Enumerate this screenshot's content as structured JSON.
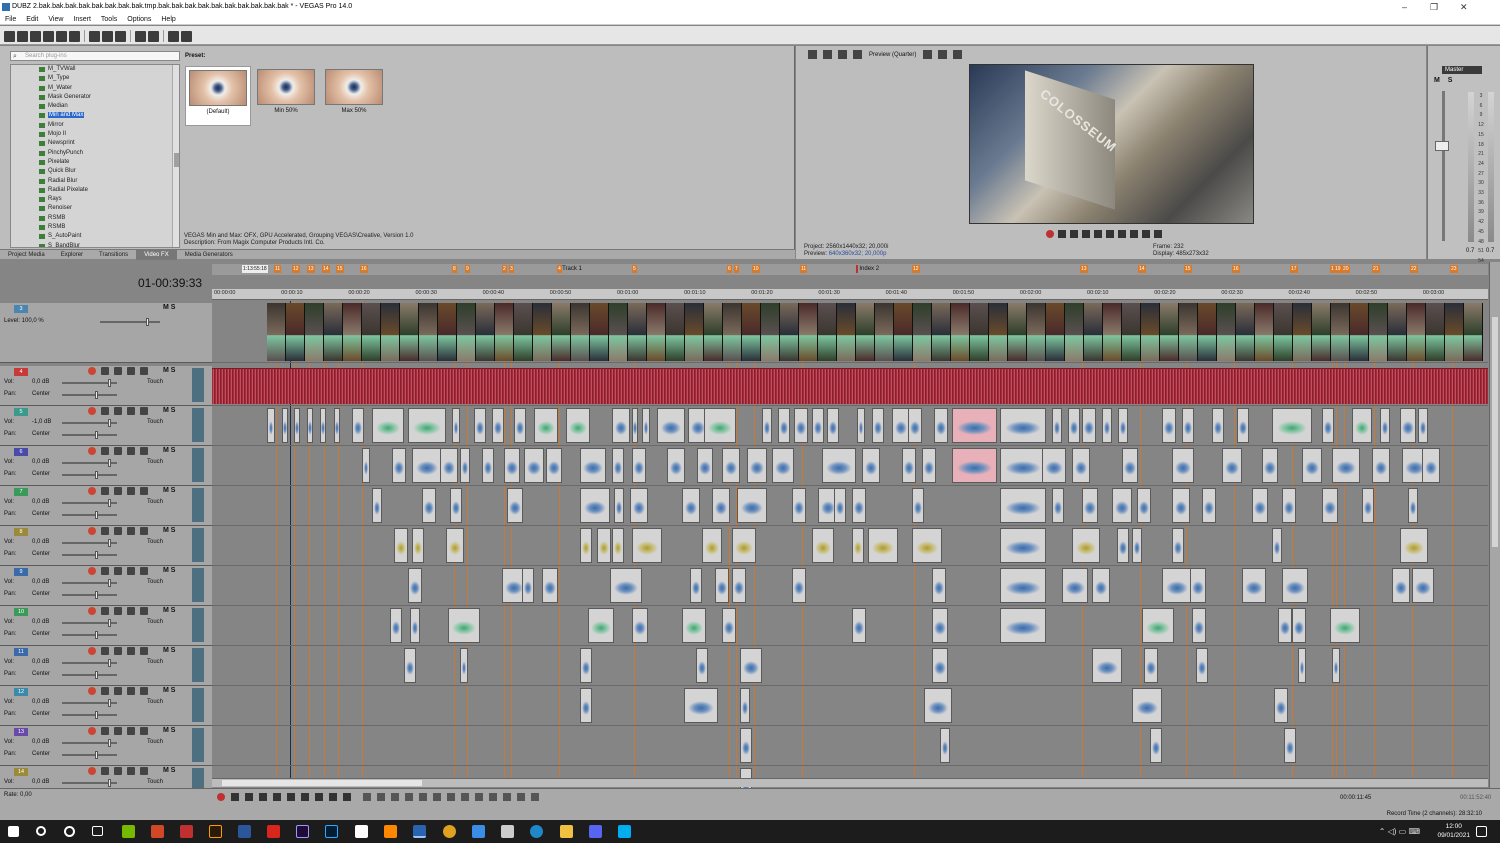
{
  "window": {
    "title": "DUBZ 2.bak.bak.bak.bak.bak.bak.bak.bak.tmp.bak.bak.bak.bak.bak.bak.bak.bak.bak.bak * - VEGAS Pro 14.0",
    "minimize": "–",
    "maximize": "❐",
    "close": "✕"
  },
  "menu": [
    "File",
    "Edit",
    "View",
    "Insert",
    "Tools",
    "Options",
    "Help"
  ],
  "fx": {
    "search_placeholder": "Search plug-ins",
    "items": [
      "M_TVWall",
      "M_Type",
      "M_Water",
      "Mask Generator",
      "Median",
      "Min and Max",
      "Mirror",
      "Mojo II",
      "Newsprint",
      "PinchyPunch",
      "Pixelate",
      "Quick Blur",
      "Radial Blur",
      "Radial Pixelate",
      "Rays",
      "Renoiser",
      "RSMB",
      "RSMB",
      "S_AutoPaint",
      "S_BandBlur"
    ],
    "selected_index": 5,
    "preset_label": "Preset:",
    "presets": [
      "(Default)",
      "Min 50%",
      "Max 50%"
    ],
    "description_line1": "VEGAS Min and Max: OFX, GPU Accelerated, Grouping VEGAS\\Creative, Version 1.0",
    "description_line2": "Description: From Magix Computer Products Intl. Co."
  },
  "left_tabs": [
    "Project Media",
    "Explorer",
    "Transitions",
    "Video FX",
    "Media Generators"
  ],
  "active_left_tab": 3,
  "preview": {
    "mode": "Preview (Quarter)",
    "project_label": "Project:",
    "project_value": "2560x1440x32; 20,000i",
    "preview_label": "Preview:",
    "preview_value": "640x360x32; 20,000p",
    "frame_label": "Frame:",
    "frame_value": "232",
    "display_label": "Display:",
    "display_value": "485x273x32",
    "sign_text": "COLOSSEUM"
  },
  "master": {
    "label": "Master",
    "ms": "M S",
    "scale": [
      "3",
      "6",
      "9",
      "12",
      "15",
      "18",
      "21",
      "24",
      "27",
      "30",
      "33",
      "36",
      "39",
      "42",
      "45",
      "48",
      "51",
      "54",
      "57"
    ],
    "left_value": "0.7",
    "right_value": "0.7"
  },
  "timeline": {
    "timecode": "01-00:39:33",
    "time_selection": "1:13:55:18",
    "ruler_ticks": [
      "00:00:00",
      "00:00:10",
      "00:00:20",
      "00:00:30",
      "00:00:40",
      "00:00:50",
      "00:01:00",
      "00:01:10",
      "00:01:20",
      "00:01:30",
      "00:01:40",
      "00:01:50",
      "00:02:00",
      "00:02:10",
      "00:02:20",
      "00:02:30",
      "00:02:40",
      "00:02:50",
      "00:03:00"
    ],
    "regions": [
      {
        "label": "Track 1",
        "pos": 0.272
      },
      {
        "label": "Index 2",
        "pos": 0.505
      }
    ],
    "marker_labels": [
      "11",
      "12",
      "13",
      "14",
      "15",
      "16",
      "8",
      "9",
      "2",
      "3",
      "4",
      "5",
      "6",
      "7",
      "10",
      "11",
      "12",
      "13",
      "14",
      "15",
      "16",
      "17",
      "18",
      "19",
      "20",
      "21",
      "22",
      "23"
    ],
    "video_track": {
      "number": "3",
      "level_label": "Level: 100,0 %"
    },
    "audio_tracks": [
      {
        "number": "4",
        "vol_label": "Vol:",
        "vol": "0,0 dB",
        "pan_label": "Pan:",
        "pan": "Center",
        "touch": "Touch",
        "color": "#c83a3a"
      },
      {
        "number": "5",
        "vol_label": "Vol:",
        "vol": "-1,0 dB",
        "pan_label": "Pan:",
        "pan": "Center",
        "touch": "Touch",
        "color": "#3b9a8a"
      },
      {
        "number": "6",
        "vol_label": "Vol:",
        "vol": "0,0 dB",
        "pan_label": "Pan:",
        "pan": "Center",
        "touch": "Touch",
        "color": "#4a4aa8"
      },
      {
        "number": "7",
        "vol_label": "Vol:",
        "vol": "0,0 dB",
        "pan_label": "Pan:",
        "pan": "Center",
        "touch": "Touch",
        "color": "#3b9a5a"
      },
      {
        "number": "8",
        "vol_label": "Vol:",
        "vol": "0,0 dB",
        "pan_label": "Pan:",
        "pan": "Center",
        "touch": "Touch",
        "color": "#9a8a3a"
      },
      {
        "number": "9",
        "vol_label": "Vol:",
        "vol": "0,0 dB",
        "pan_label": "Pan:",
        "pan": "Center",
        "touch": "Touch",
        "color": "#3a6aa8"
      },
      {
        "number": "10",
        "vol_label": "Vol:",
        "vol": "0,0 dB",
        "pan_label": "Pan:",
        "pan": "Center",
        "touch": "Touch",
        "color": "#3b9a5a"
      },
      {
        "number": "11",
        "vol_label": "Vol:",
        "vol": "0,0 dB",
        "pan_label": "Pan:",
        "pan": "Center",
        "touch": "Touch",
        "color": "#3a6aa8"
      },
      {
        "number": "12",
        "vol_label": "Vol:",
        "vol": "0,0 dB",
        "pan_label": "Pan:",
        "pan": "Center",
        "touch": "Touch",
        "color": "#3b8aa8"
      },
      {
        "number": "13",
        "vol_label": "Vol:",
        "vol": "0,0 dB",
        "pan_label": "Pan:",
        "pan": "Center",
        "touch": "Touch",
        "color": "#6a4aa8"
      },
      {
        "number": "14",
        "vol_label": "Vol:",
        "vol": "0,0 dB",
        "pan_label": "Pan:",
        "pan": "Center",
        "touch": "Touch",
        "color": "#9a8a3a"
      }
    ]
  },
  "status": {
    "rate": "Rate: 0,00",
    "cursor_time": "00:00:11:45",
    "selection_length": "00:11:52:40",
    "record_time": "Record Time (2 channels): 28:32:10"
  },
  "clock": {
    "time": "12:00",
    "date": "09/01/2021"
  }
}
